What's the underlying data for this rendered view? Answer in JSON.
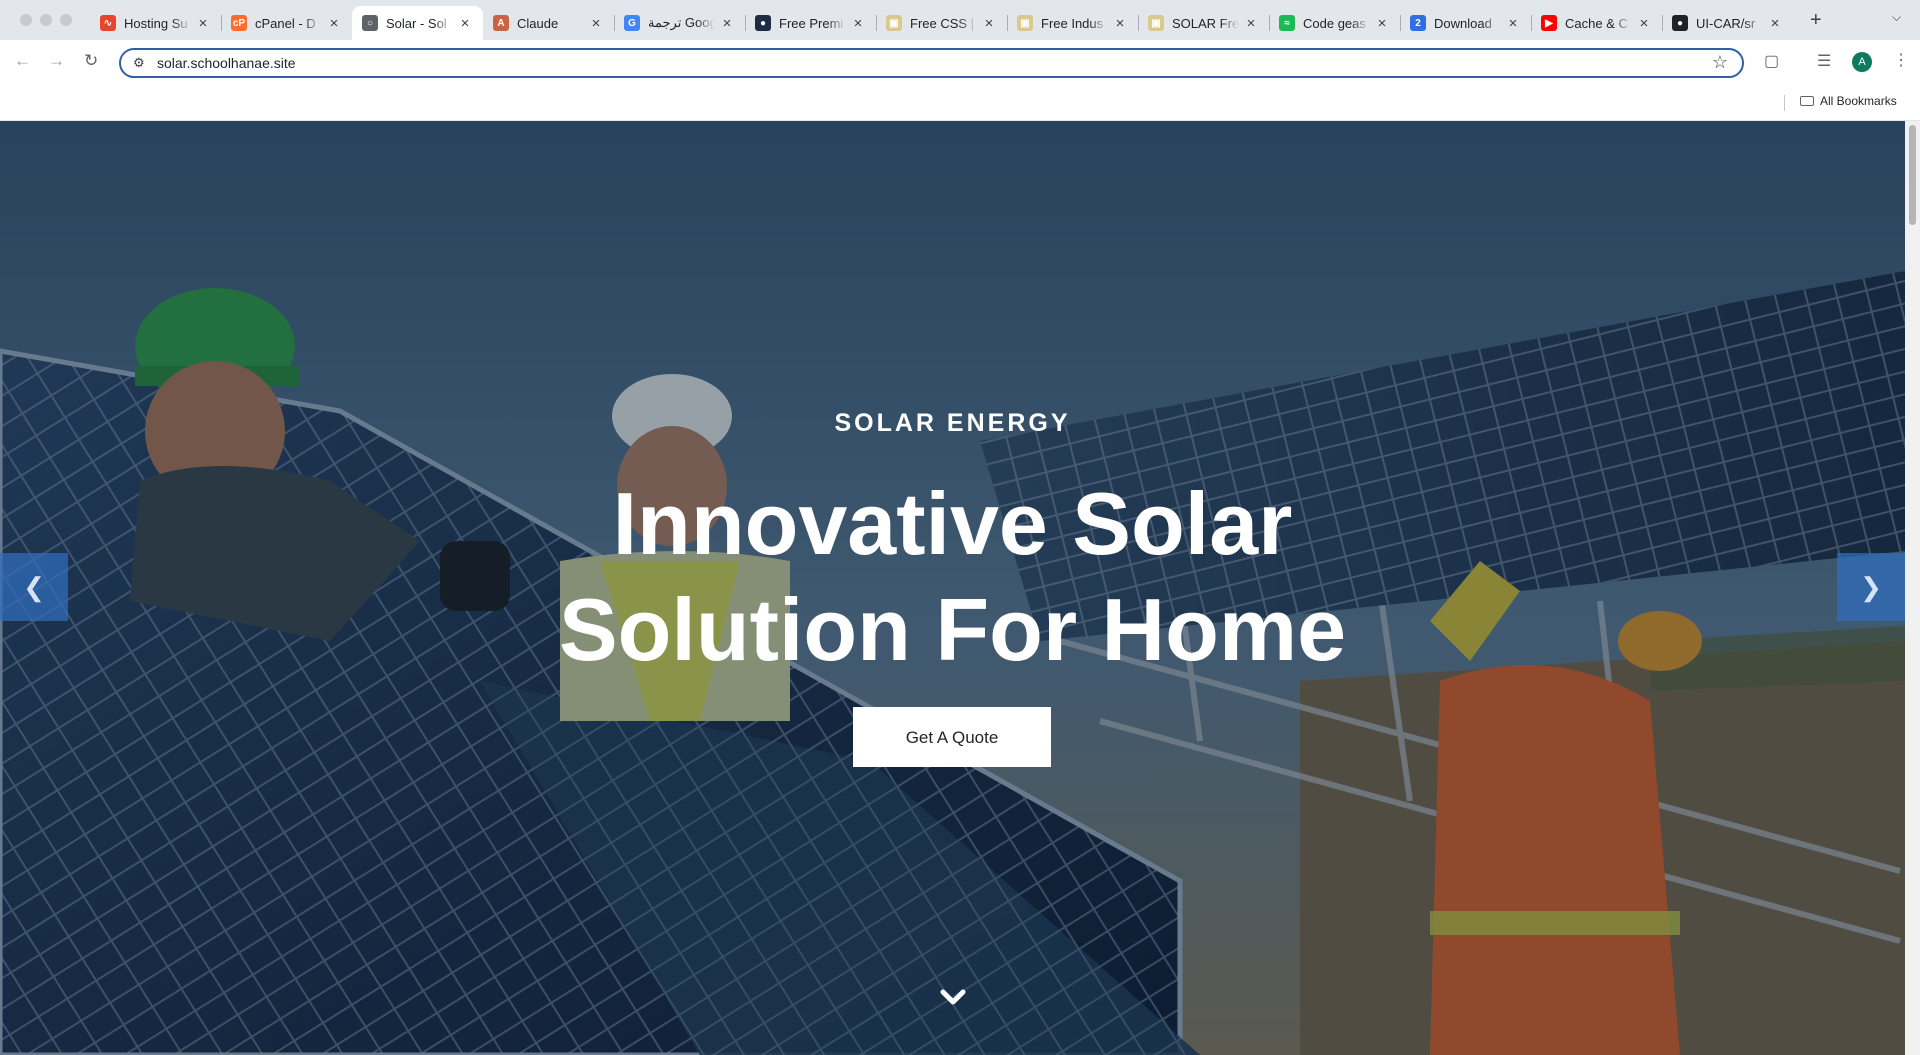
{
  "browser": {
    "tabs": [
      {
        "title": "Hosting Su",
        "icon": "hosting-logo-icon",
        "color": "#e8452c"
      },
      {
        "title": "cPanel - D",
        "icon": "cpanel-logo-icon",
        "color": "#ff6c2c"
      },
      {
        "title": "Solar - Sol",
        "icon": "globe-icon",
        "color": "#5f6368"
      },
      {
        "title": "Claude",
        "icon": "claude-logo-icon",
        "color": "#c96442"
      },
      {
        "title": "ترجمة Google",
        "icon": "google-translate-icon",
        "color": "#4285f4"
      },
      {
        "title": "Free Premi",
        "icon": "mask-logo-icon",
        "color": "#1f2a44"
      },
      {
        "title": "Free CSS |",
        "icon": "freecss-logo-icon",
        "color": "#d9c98a"
      },
      {
        "title": "Free Indus",
        "icon": "freecss-logo-icon",
        "color": "#d9c98a"
      },
      {
        "title": "SOLAR Fre",
        "icon": "freecss-logo-icon",
        "color": "#d9c98a"
      },
      {
        "title": "Code geas",
        "icon": "spotify-logo-icon",
        "color": "#1db954"
      },
      {
        "title": "Download",
        "icon": "download-logo-icon",
        "color": "#2f6fe0"
      },
      {
        "title": "Cache & C",
        "icon": "youtube-logo-icon",
        "color": "#ff0000"
      },
      {
        "title": "UI-CAR/sr",
        "icon": "github-logo-icon",
        "color": "#1f2328"
      }
    ],
    "active_tab": 2,
    "address": "solar.schoolhanae.site",
    "profile_initial": "A",
    "all_bookmarks": "All Bookmarks"
  },
  "hero": {
    "subtitle": "SOLAR ENERGY",
    "title_line1": "Innovative Solar",
    "title_line2": "Solution For Home",
    "cta_label": "Get A Quote"
  }
}
